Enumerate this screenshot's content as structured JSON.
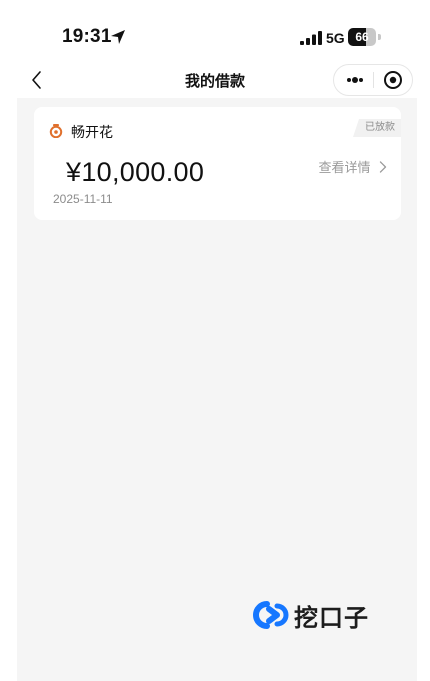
{
  "status_bar": {
    "time": "19:31",
    "network": "5G",
    "battery_level": "66"
  },
  "nav": {
    "title": "我的借款"
  },
  "loan": {
    "product_name": "畅开花",
    "status": "已放款",
    "amount": "¥10,000.00",
    "date": "2025-11-11",
    "detail_label": "查看详情"
  },
  "watermark": {
    "text": "挖口子"
  },
  "colors": {
    "brand": "#e0702d",
    "watermark_blue": "#1677ff"
  }
}
